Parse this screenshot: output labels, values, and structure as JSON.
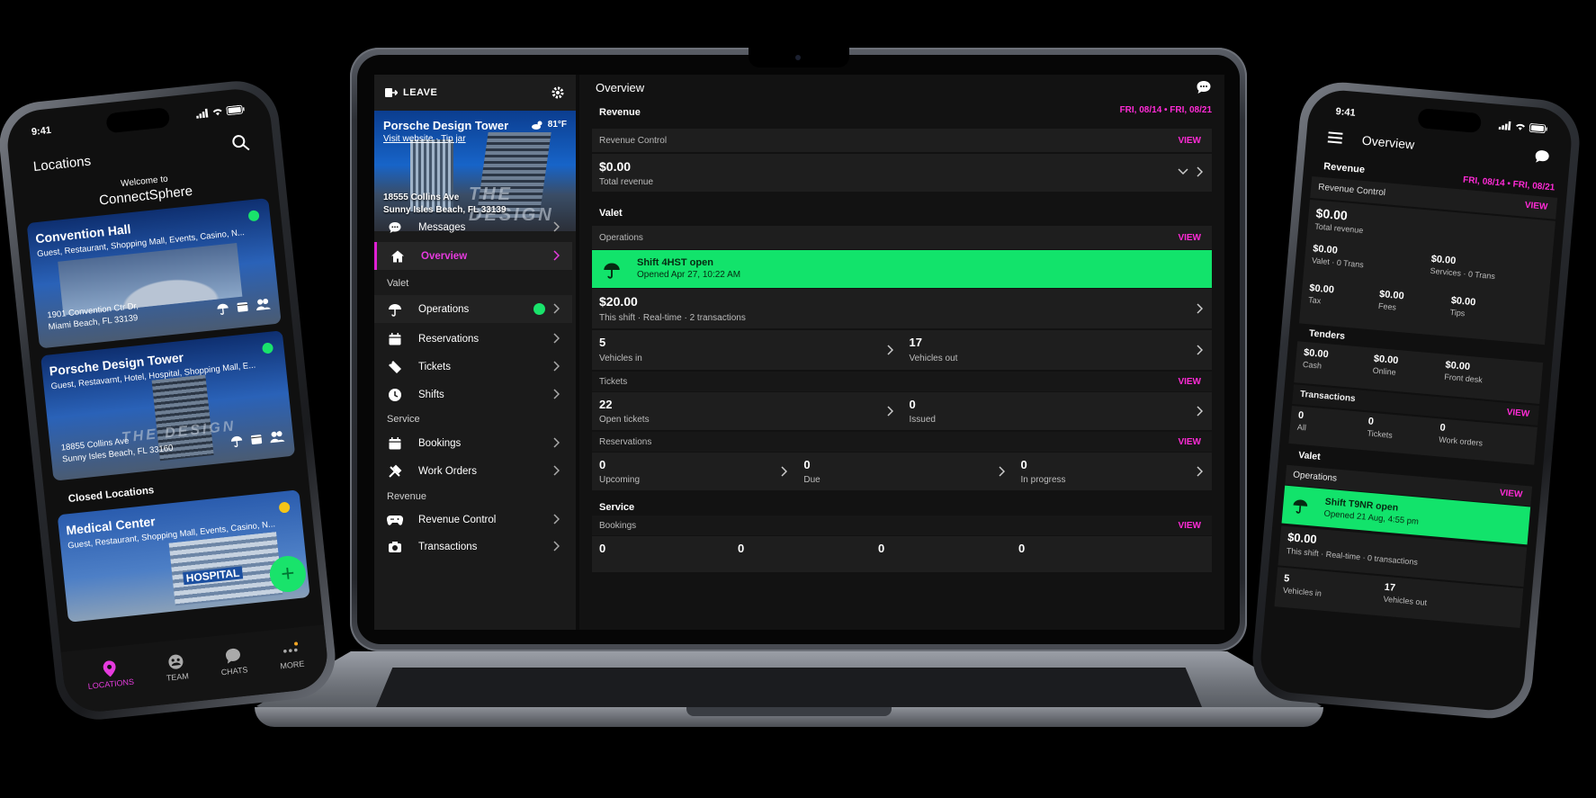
{
  "laptop": {
    "sidebar": {
      "leave_label": "LEAVE",
      "location": {
        "name": "Porsche Design Tower",
        "visit_link": "Visit website",
        "tip_link": "Tip jar",
        "separator": "·",
        "temperature": "81°F",
        "address_line1": "18555 Collins Ave",
        "address_line2": "Sunny Isles Beach, FL 33139",
        "watermark": "THE DESIGN"
      },
      "items": [
        {
          "label": "Messages",
          "icon": "chat-icon"
        },
        {
          "label": "Overview",
          "icon": "home-icon",
          "active": true
        },
        {
          "label": "Operations",
          "icon": "umbrella-icon",
          "status": "green"
        },
        {
          "label": "Reservations",
          "icon": "calendar-icon"
        },
        {
          "label": "Tickets",
          "icon": "ticket-icon"
        },
        {
          "label": "Shifts",
          "icon": "clock-icon"
        },
        {
          "label": "Bookings",
          "icon": "calendar-icon"
        },
        {
          "label": "Work Orders",
          "icon": "tools-icon"
        },
        {
          "label": "Revenue Control",
          "icon": "gamepad-icon"
        },
        {
          "label": "Transactions",
          "icon": "camera-icon"
        }
      ],
      "sections": {
        "valet": "Valet",
        "service": "Service",
        "revenue": "Revenue"
      }
    },
    "main": {
      "title": "Overview",
      "revenue": {
        "heading": "Revenue",
        "date_range": "FRI, 08/14 • FRI, 08/21",
        "control_label": "Revenue Control",
        "view": "VIEW",
        "total": "$0.00",
        "total_label": "Total revenue"
      },
      "valet": {
        "heading": "Valet",
        "operations_label": "Operations",
        "view": "VIEW",
        "shift_title": "Shift 4HST open",
        "shift_opened": "Opened Apr 27, 10:22 AM",
        "amount": "$20.00",
        "amount_sub": "This shift · Real-time · 2 transactions",
        "vehicles_in": "5",
        "vehicles_in_label": "Vehicles in",
        "vehicles_out": "17",
        "vehicles_out_label": "Vehicles out",
        "tickets_label": "Tickets",
        "open_tickets": "22",
        "open_tickets_label": "Open tickets",
        "issued": "0",
        "issued_label": "Issued",
        "reservations_label": "Reservations",
        "upcoming": "0",
        "upcoming_label": "Upcoming",
        "due": "0",
        "due_label": "Due",
        "in_progress": "0",
        "in_progress_label": "In progress"
      },
      "service": {
        "heading": "Service",
        "bookings_label": "Bookings",
        "view": "VIEW",
        "values": [
          "0",
          "0",
          "0",
          "0"
        ]
      }
    }
  },
  "left_phone": {
    "time": "9:41",
    "title": "Locations",
    "welcome": "Welcome to",
    "app_name": "ConnectSphere",
    "locations": [
      {
        "name": "Convention Hall",
        "tags": "Guest, Restaurant, Shopping Mall, Events, Casino, N...",
        "address1": "1901 Convention Ctr Dr,",
        "address2": "Miami Beach, FL 33139"
      },
      {
        "name": "Porsche Design Tower",
        "tags": "Guest, Restavarnt, Hotel, Hospital, Shopping Mall, E...",
        "address1": "18855 Collins Ave",
        "address2": "Sunny Isles Beach, FL 33160",
        "watermark": "THE DESIGN"
      }
    ],
    "closed_heading": "Closed Locations",
    "closed": {
      "name": "Medical Center",
      "tags": "Guest, Restaurant, Shopping Mall, Events, Casino, N...",
      "sign": "HOSPITAL"
    },
    "fab": "+",
    "tabs": [
      "LOCATIONS",
      "TEAM",
      "CHATS",
      "MORE"
    ]
  },
  "right_phone": {
    "time": "9:41",
    "title": "Overview",
    "revenue": "Revenue",
    "date_range": "FRI, 08/14 • FRI, 08/21",
    "control": "Revenue Control",
    "view": "VIEW",
    "total": "$0.00",
    "total_label": "Total revenue",
    "valet_amt": "$0.00",
    "valet_label": "Valet · 0 Trans",
    "services_amt": "$0.00",
    "services_label": "Services · 0 Trans",
    "tax": "$0.00",
    "tax_label": "Tax",
    "fees": "$0.00",
    "fees_label": "Fees",
    "tips": "$0.00",
    "tips_label": "Tips",
    "tenders": "Tenders",
    "cash": "$0.00",
    "cash_label": "Cash",
    "online": "$0.00",
    "online_label": "Online",
    "frontdesk": "$0.00",
    "frontdesk_label": "Front desk",
    "transactions": "Transactions",
    "all": "0",
    "all_label": "All",
    "tickets": "0",
    "tickets_label": "Tickets",
    "work": "0",
    "work_label": "Work orders",
    "valet": "Valet",
    "operations": "Operations",
    "shift": "Shift T9NR open",
    "shift_opened": "Opened 21 Aug, 4:55 pm",
    "shift_amt": "$0.00",
    "shift_sub": "This shift · Real-time · 0 transactions",
    "vin": "5",
    "vin_label": "Vehicles in",
    "vout": "17",
    "vout_label": "Vehicles out"
  },
  "colors": {
    "accent": "#e63bde",
    "green": "#12e36b",
    "bg": "#121212"
  }
}
